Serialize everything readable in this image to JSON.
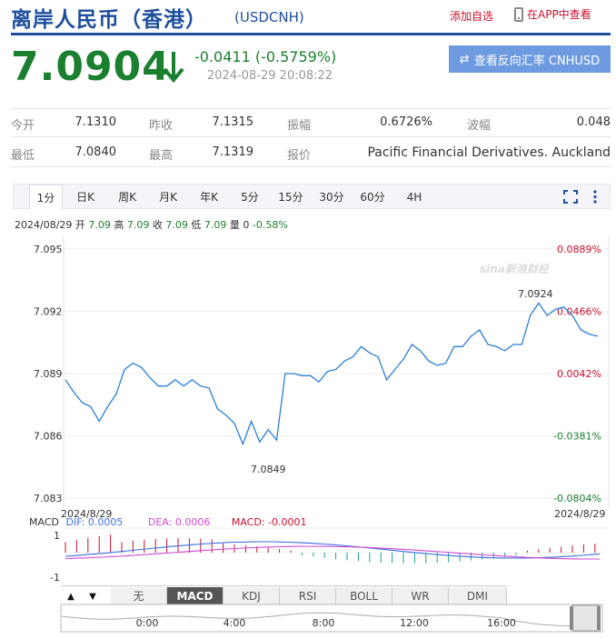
{
  "header": {
    "title": "离岸人民币（香港）",
    "symbol": "(USDCNH)",
    "follow_label": "添加自选",
    "app_label": "在APP中查看",
    "price": "7.0904",
    "change": "-0.0411 (-0.5759%)",
    "timestamp": "2024-08-29 20:08:22",
    "reverse_button": "查看反向汇率 CNHUSD"
  },
  "stats": {
    "open_label": "今开",
    "open": "7.1310",
    "prev_close_label": "昨收",
    "prev_close": "7.1315",
    "amplitude_label": "振幅",
    "amplitude": "0.6726%",
    "wave_label": "波幅",
    "wave": "0.048",
    "low_label": "最低",
    "low": "7.0840",
    "high_label": "最高",
    "high": "7.1319",
    "quote_label": "报价",
    "quote": "Pacific Financial Derivatives. Auckland"
  },
  "period_tabs": [
    "1分",
    "日K",
    "周K",
    "月K",
    "年K",
    "5分",
    "15分",
    "30分",
    "60分",
    "4H"
  ],
  "active_period": "1分",
  "info_bar": {
    "date": "2024/08/29",
    "open_label": "开",
    "open": "7.09",
    "high_label": "高",
    "high": "7.09",
    "close_label": "收",
    "close": "7.09",
    "low_label": "低",
    "low": "7.09",
    "vol_label": "量",
    "vol": "0",
    "change_pct": "-0.58%"
  },
  "watermark": "sina新浪财经",
  "chart_data": {
    "type": "line",
    "y_ticks": [
      "7.095",
      "7.092",
      "7.089",
      "7.086",
      "7.083"
    ],
    "pct_ticks": [
      "0.0889%",
      "0.0466%",
      "0.0042%",
      "-0.0381%",
      "-0.0804%"
    ],
    "ylim": [
      7.083,
      7.095
    ],
    "max_label": "7.0924",
    "min_label": "7.0849",
    "x": [
      0,
      1,
      2,
      3,
      4,
      5,
      6,
      7,
      8,
      9,
      10,
      11,
      12,
      13,
      14,
      15,
      16,
      17,
      18,
      19,
      20,
      21,
      22,
      23,
      24,
      25,
      26,
      27,
      28,
      29,
      30,
      31,
      32,
      33,
      34,
      35,
      36,
      37,
      38,
      39,
      40,
      41,
      42,
      43,
      44,
      45,
      46,
      47,
      48,
      49,
      50,
      51,
      52,
      53,
      54,
      55,
      56,
      57,
      58,
      59,
      60,
      61,
      62,
      63
    ],
    "values": [
      7.0887,
      7.0881,
      7.0876,
      7.0874,
      7.0867,
      7.0874,
      7.088,
      7.0892,
      7.0895,
      7.0893,
      7.0888,
      7.0884,
      7.0884,
      7.0887,
      7.0884,
      7.0887,
      7.0884,
      7.0883,
      7.0873,
      7.087,
      7.0866,
      7.0856,
      7.0867,
      7.0857,
      7.0863,
      7.0858,
      7.089,
      7.089,
      7.0889,
      7.0889,
      7.0886,
      7.0891,
      7.0892,
      7.0896,
      7.0898,
      7.0903,
      7.09,
      7.0898,
      7.0887,
      7.0892,
      7.0897,
      7.0904,
      7.0901,
      7.0896,
      7.0894,
      7.0895,
      7.0903,
      7.0903,
      7.0908,
      7.0911,
      7.0904,
      7.0903,
      7.0901,
      7.0904,
      7.0904,
      7.0918,
      7.0924,
      7.0918,
      7.0921,
      7.0922,
      7.0918,
      7.0911,
      7.0909,
      7.0908
    ]
  },
  "macd": {
    "date_left": "2024/8/29",
    "date_right": "2024/8/29",
    "label": "MACD",
    "dif_label": "DIF: 0.0005",
    "dea_label": "DEA: 0.0006",
    "macd_label": "MACD: -0.0001",
    "tick_top": "1",
    "tick_bottom": "-1"
  },
  "indicator_tabs": [
    "无",
    "MACD",
    "KDJ",
    "RSI",
    "BOLL",
    "WR",
    "DMI"
  ],
  "active_indicator": "MACD",
  "timeline_labels": [
    "0:00",
    "4:00",
    "8:00",
    "12:00",
    "16:00"
  ],
  "colors": {
    "down_green": "#1a7f2e",
    "up_red": "#c8102e",
    "line_blue": "#2a7fd4",
    "brand_blue": "#1d4f9e"
  }
}
